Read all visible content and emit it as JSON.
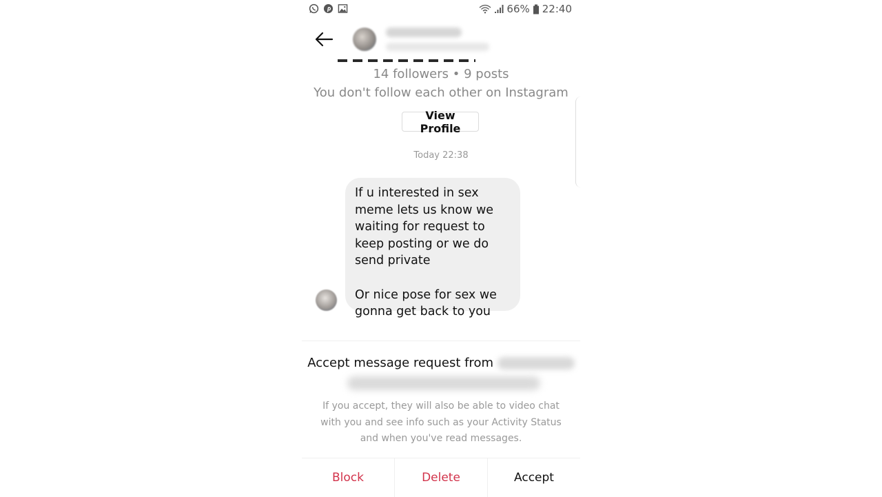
{
  "status_bar": {
    "left_icons": [
      "whatsapp-icon",
      "pinterest-icon",
      "image-icon"
    ],
    "right_icons": [
      "wifi-icon",
      "signal-icon"
    ],
    "battery_percent": "66%",
    "time": "22:40"
  },
  "header": {
    "back_icon": "arrow-left-icon",
    "username": "[blurred]",
    "handle": "[blurred]"
  },
  "profile_summary": {
    "followers_posts": "14 followers • 9 posts",
    "follow_status": "You don't follow each other on Instagram",
    "view_profile_label": "View Profile"
  },
  "conversation": {
    "timestamp": "Today 22:38",
    "messages": [
      {
        "sender": "other",
        "paragraphs": [
          "If u interested in sex meme lets us know we waiting for request to keep posting or we do send private",
          "Or nice pose for sex we gonna get back to you"
        ]
      }
    ]
  },
  "request_panel": {
    "title_prefix": "Accept message request from",
    "sender_name": "[blurred]",
    "sender_handle": "[blurred]",
    "description": "If you accept, they will also be able to video chat with you and see info such as your Activity Status and when you've read messages."
  },
  "actions": {
    "block_label": "Block",
    "delete_label": "Delete",
    "accept_label": "Accept",
    "danger_color": "#d2334b"
  }
}
